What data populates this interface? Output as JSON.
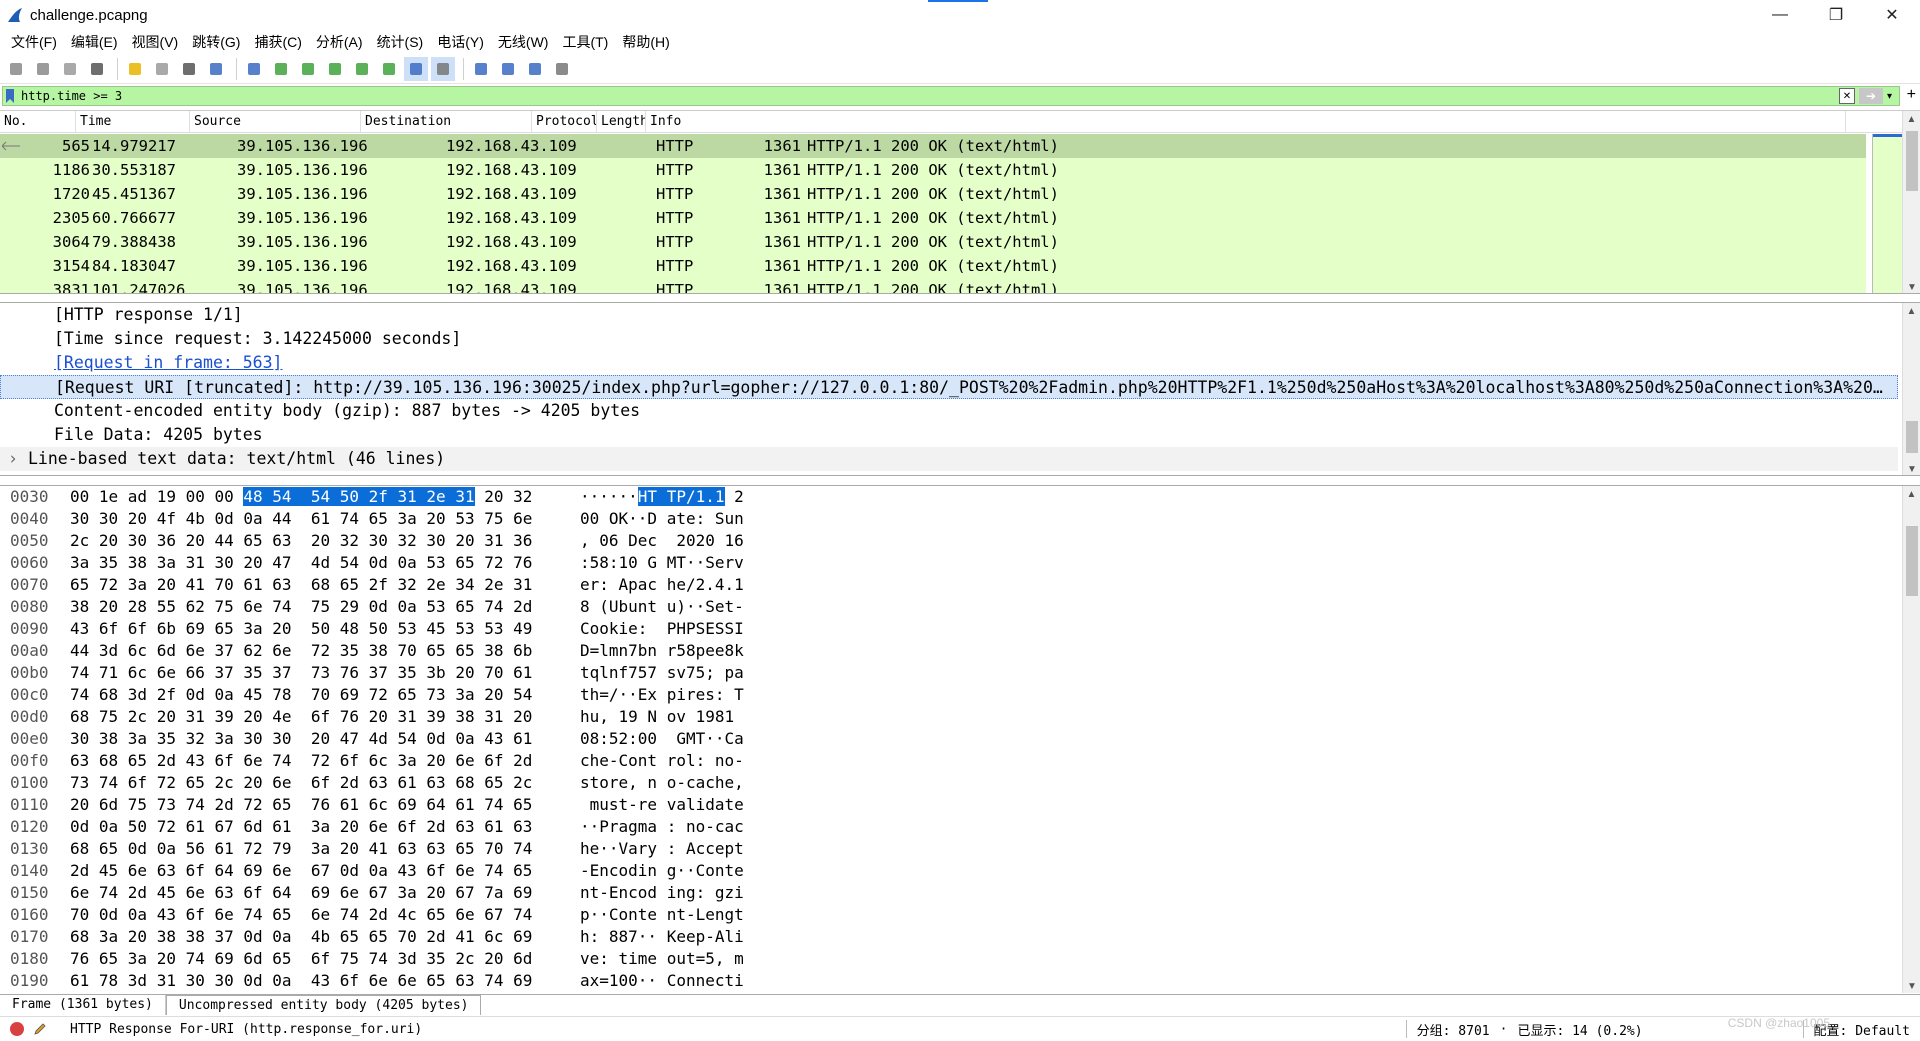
{
  "window": {
    "title": "challenge.pcapng"
  },
  "menu": [
    "文件(F)",
    "编辑(E)",
    "视图(V)",
    "跳转(G)",
    "捕获(C)",
    "分析(A)",
    "统计(S)",
    "电话(Y)",
    "无线(W)",
    "工具(T)",
    "帮助(H)"
  ],
  "toolbar": {
    "icons": [
      "start-capture-icon",
      "stop-capture-icon",
      "restart-capture-icon",
      "capture-options-icon",
      "sep",
      "open-file-icon",
      "save-file-icon",
      "close-file-icon",
      "reload-file-icon",
      "sep",
      "find-packet-icon",
      "go-back-icon",
      "go-forward-icon",
      "go-to-packet-icon",
      "first-packet-icon",
      "last-packet-icon",
      "auto-scroll-icon",
      "colorize-icon",
      "sep",
      "zoom-in-icon",
      "zoom-out-icon",
      "normal-size-icon",
      "resize-columns-icon"
    ]
  },
  "filter": {
    "value": "http.time >= 3"
  },
  "packet_list": {
    "columns": [
      "No.",
      "Time",
      "Source",
      "Destination",
      "Protocol",
      "Length",
      "Info"
    ],
    "rows": [
      {
        "no": "565",
        "time": "14.979217",
        "src": "39.105.136.196",
        "dst": "192.168.43.109",
        "proto": "HTTP",
        "len": "1361",
        "info": "HTTP/1.1 200 OK  (text/html)",
        "selected": true
      },
      {
        "no": "1186",
        "time": "30.553187",
        "src": "39.105.136.196",
        "dst": "192.168.43.109",
        "proto": "HTTP",
        "len": "1361",
        "info": "HTTP/1.1 200 OK  (text/html)"
      },
      {
        "no": "1720",
        "time": "45.451367",
        "src": "39.105.136.196",
        "dst": "192.168.43.109",
        "proto": "HTTP",
        "len": "1361",
        "info": "HTTP/1.1 200 OK  (text/html)"
      },
      {
        "no": "2305",
        "time": "60.766677",
        "src": "39.105.136.196",
        "dst": "192.168.43.109",
        "proto": "HTTP",
        "len": "1361",
        "info": "HTTP/1.1 200 OK  (text/html)"
      },
      {
        "no": "3064",
        "time": "79.388438",
        "src": "39.105.136.196",
        "dst": "192.168.43.109",
        "proto": "HTTP",
        "len": "1361",
        "info": "HTTP/1.1 200 OK  (text/html)"
      },
      {
        "no": "3154",
        "time": "84.183047",
        "src": "39.105.136.196",
        "dst": "192.168.43.109",
        "proto": "HTTP",
        "len": "1361",
        "info": "HTTP/1.1 200 OK  (text/html)"
      },
      {
        "no": "3831",
        "time": "101.247026",
        "src": "39.105.136.196",
        "dst": "192.168.43.109",
        "proto": "HTTP",
        "len": "1361",
        "info": "HTTP/1.1 200 OK  (text/html)"
      }
    ]
  },
  "detail": {
    "lines": [
      {
        "text": "[HTTP response 1/1]",
        "kind": "normal"
      },
      {
        "text": "[Time since request: 3.142245000 seconds]",
        "kind": "normal"
      },
      {
        "text": "[Request in frame: 563]",
        "kind": "link"
      },
      {
        "text": "[Request URI [truncated]: http://39.105.136.196:30025/index.php?url=gopher://127.0.0.1:80/_POST%20%2Fadmin.php%20HTTP%2F1.1%250d%250aHost%3A%20localhost%3A80%250d%250aConnection%3A%20…",
        "kind": "selected"
      },
      {
        "text": "Content-encoded entity body (gzip): 887 bytes -> 4205 bytes",
        "kind": "normal"
      },
      {
        "text": "File Data: 4205 bytes",
        "kind": "normal"
      },
      {
        "text": "Line-based text data: text/html (46 lines)",
        "kind": "top"
      }
    ]
  },
  "bytes": {
    "rows": [
      {
        "off": "0030",
        "hex_a": "00 1e ad 19 00 00 ",
        "hex_hl": "48 54  54 50 2f 31 2e 31",
        "hex_b": " 20 32",
        "asc_a": "······",
        "asc_hl": "HT TP/1.1",
        "asc_b": " 2"
      },
      {
        "off": "0040",
        "hex": "30 30 20 4f 4b 0d 0a 44  61 74 65 3a 20 53 75 6e",
        "asc": "00 OK··D ate: Sun"
      },
      {
        "off": "0050",
        "hex": "2c 20 30 36 20 44 65 63  20 32 30 32 30 20 31 36",
        "asc": ", 06 Dec  2020 16"
      },
      {
        "off": "0060",
        "hex": "3a 35 38 3a 31 30 20 47  4d 54 0d 0a 53 65 72 76",
        "asc": ":58:10 G MT··Serv"
      },
      {
        "off": "0070",
        "hex": "65 72 3a 20 41 70 61 63  68 65 2f 32 2e 34 2e 31",
        "asc": "er: Apac he/2.4.1"
      },
      {
        "off": "0080",
        "hex": "38 20 28 55 62 75 6e 74  75 29 0d 0a 53 65 74 2d",
        "asc": "8 (Ubunt u)··Set-"
      },
      {
        "off": "0090",
        "hex": "43 6f 6f 6b 69 65 3a 20  50 48 50 53 45 53 53 49",
        "asc": "Cookie:  PHPSESSI"
      },
      {
        "off": "00a0",
        "hex": "44 3d 6c 6d 6e 37 62 6e  72 35 38 70 65 65 38 6b",
        "asc": "D=lmn7bn r58pee8k"
      },
      {
        "off": "00b0",
        "hex": "74 71 6c 6e 66 37 35 37  73 76 37 35 3b 20 70 61",
        "asc": "tqlnf757 sv75; pa"
      },
      {
        "off": "00c0",
        "hex": "74 68 3d 2f 0d 0a 45 78  70 69 72 65 73 3a 20 54",
        "asc": "th=/··Ex pires: T"
      },
      {
        "off": "00d0",
        "hex": "68 75 2c 20 31 39 20 4e  6f 76 20 31 39 38 31 20",
        "asc": "hu, 19 N ov 1981 "
      },
      {
        "off": "00e0",
        "hex": "30 38 3a 35 32 3a 30 30  20 47 4d 54 0d 0a 43 61",
        "asc": "08:52:00  GMT··Ca"
      },
      {
        "off": "00f0",
        "hex": "63 68 65 2d 43 6f 6e 74  72 6f 6c 3a 20 6e 6f 2d",
        "asc": "che-Cont rol: no-"
      },
      {
        "off": "0100",
        "hex": "73 74 6f 72 65 2c 20 6e  6f 2d 63 61 63 68 65 2c",
        "asc": "store, n o-cache,"
      },
      {
        "off": "0110",
        "hex": "20 6d 75 73 74 2d 72 65  76 61 6c 69 64 61 74 65",
        "asc": " must-re validate"
      },
      {
        "off": "0120",
        "hex": "0d 0a 50 72 61 67 6d 61  3a 20 6e 6f 2d 63 61 63",
        "asc": "··Pragma : no-cac"
      },
      {
        "off": "0130",
        "hex": "68 65 0d 0a 56 61 72 79  3a 20 41 63 63 65 70 74",
        "asc": "he··Vary : Accept"
      },
      {
        "off": "0140",
        "hex": "2d 45 6e 63 6f 64 69 6e  67 0d 0a 43 6f 6e 74 65",
        "asc": "-Encodin g··Conte"
      },
      {
        "off": "0150",
        "hex": "6e 74 2d 45 6e 63 6f 64  69 6e 67 3a 20 67 7a 69",
        "asc": "nt-Encod ing: gzi"
      },
      {
        "off": "0160",
        "hex": "70 0d 0a 43 6f 6e 74 65  6e 74 2d 4c 65 6e 67 74",
        "asc": "p··Conte nt-Lengt"
      },
      {
        "off": "0170",
        "hex": "68 3a 20 38 38 37 0d 0a  4b 65 65 70 2d 41 6c 69",
        "asc": "h: 887·· Keep-Ali"
      },
      {
        "off": "0180",
        "hex": "76 65 3a 20 74 69 6d 65  6f 75 74 3d 35 2c 20 6d",
        "asc": "ve: time out=5, m"
      },
      {
        "off": "0190",
        "hex": "61 78 3d 31 30 30 0d 0a  43 6f 6e 6e 65 63 74 69",
        "asc": "ax=100·· Connecti"
      }
    ]
  },
  "byte_tabs": [
    "Frame (1361 bytes)",
    "Uncompressed entity body (4205 bytes)"
  ],
  "status": {
    "field": "HTTP Response For-URI (http.response_for.uri)",
    "packets": "分组: 8701",
    "displayed": "已显示: 14 (0.2%)",
    "profile": "配置: Default"
  },
  "watermark": "CSDN @zhao1005"
}
